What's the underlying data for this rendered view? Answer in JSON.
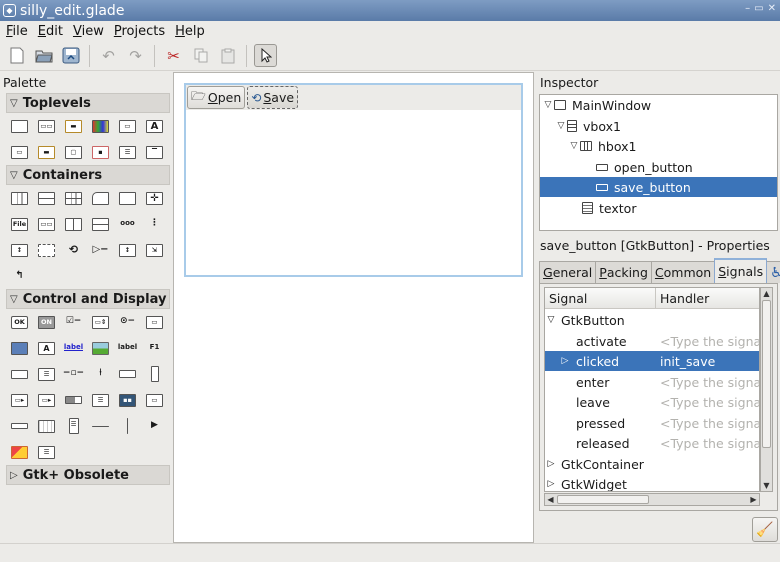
{
  "window": {
    "title": "silly_edit.glade",
    "icon": "glade-icon"
  },
  "menubar": {
    "items": [
      {
        "label": "File",
        "mnemonic": "F",
        "rest": "ile"
      },
      {
        "label": "Edit",
        "mnemonic": "E",
        "rest": "dit"
      },
      {
        "label": "View",
        "mnemonic": "V",
        "rest": "iew"
      },
      {
        "label": "Projects",
        "mnemonic": "P",
        "rest": "rojects"
      },
      {
        "label": "Help",
        "mnemonic": "H",
        "rest": "elp"
      }
    ]
  },
  "toolbar": {
    "items": [
      "new-icon",
      "open-icon",
      "save-icon",
      "undo-icon",
      "redo-icon",
      "cut-icon",
      "copy-icon",
      "paste-icon",
      "selector-icon"
    ]
  },
  "palette": {
    "label": "Palette",
    "groups": [
      {
        "label": "Toplevels",
        "expanded": true
      },
      {
        "label": "Containers",
        "expanded": true
      },
      {
        "label": "Control and Display",
        "expanded": true
      },
      {
        "label": "Gtk+ Obsolete",
        "expanded": false
      }
    ],
    "mini_labels": {
      "file": "File",
      "ok": "OK",
      "on": "ON",
      "label_link": "label",
      "label": "label",
      "f1": "F1",
      "big_a": "A",
      "a": "A",
      "dots": "ooo"
    }
  },
  "design": {
    "buttons": [
      {
        "label": "Open",
        "mnemonic": "O",
        "rest": "pen",
        "icon": "folder-open-icon"
      },
      {
        "label": "Save",
        "mnemonic": "S",
        "rest": "ave",
        "icon": "save-icon"
      }
    ]
  },
  "inspector": {
    "label": "Inspector",
    "tree": [
      {
        "name": "MainWindow",
        "depth": 0,
        "expander": "expanded",
        "icon": "window-icon"
      },
      {
        "name": "vbox1",
        "depth": 1,
        "expander": "expanded",
        "icon": "vbox-icon"
      },
      {
        "name": "hbox1",
        "depth": 2,
        "expander": "expanded",
        "icon": "hbox-icon"
      },
      {
        "name": "open_button",
        "depth": 3,
        "icon": "button-icon"
      },
      {
        "name": "save_button",
        "depth": 3,
        "icon": "button-icon",
        "selected": true
      },
      {
        "name": "textor",
        "depth": 2,
        "icon": "textview-icon"
      }
    ]
  },
  "properties": {
    "title": "save_button [GtkButton] - Properties",
    "tabs": [
      {
        "mnemonic": "G",
        "rest": "eneral"
      },
      {
        "mnemonic": "P",
        "rest": "acking"
      },
      {
        "mnemonic": "C",
        "rest": "ommon"
      },
      {
        "mnemonic": "S",
        "rest": "ignals",
        "pre": "",
        "active": true
      }
    ],
    "signals": {
      "headers": [
        "Signal",
        "Handler"
      ],
      "rows": [
        {
          "signal": "GtkButton",
          "level": 0,
          "expander": "expanded",
          "handler": ""
        },
        {
          "signal": "activate",
          "level": 1,
          "handler": "<Type the signal's handler here>",
          "placeholder": true
        },
        {
          "signal": "clicked",
          "level": 1,
          "expander": "collapsed",
          "handler": "init_save",
          "selected": true
        },
        {
          "signal": "enter",
          "level": 1,
          "handler": "<Type the signal's handler here>",
          "placeholder": true
        },
        {
          "signal": "leave",
          "level": 1,
          "handler": "<Type the signal's handler here>",
          "placeholder": true
        },
        {
          "signal": "pressed",
          "level": 1,
          "handler": "<Type the signal's handler here>",
          "placeholder": true
        },
        {
          "signal": "released",
          "level": 1,
          "handler": "<Type the signal's handler here>",
          "placeholder": true
        },
        {
          "signal": "GtkContainer",
          "level": 0,
          "expander": "collapsed",
          "handler": ""
        },
        {
          "signal": "GtkWidget",
          "level": 0,
          "expander": "collapsed",
          "handler": ""
        }
      ]
    }
  }
}
